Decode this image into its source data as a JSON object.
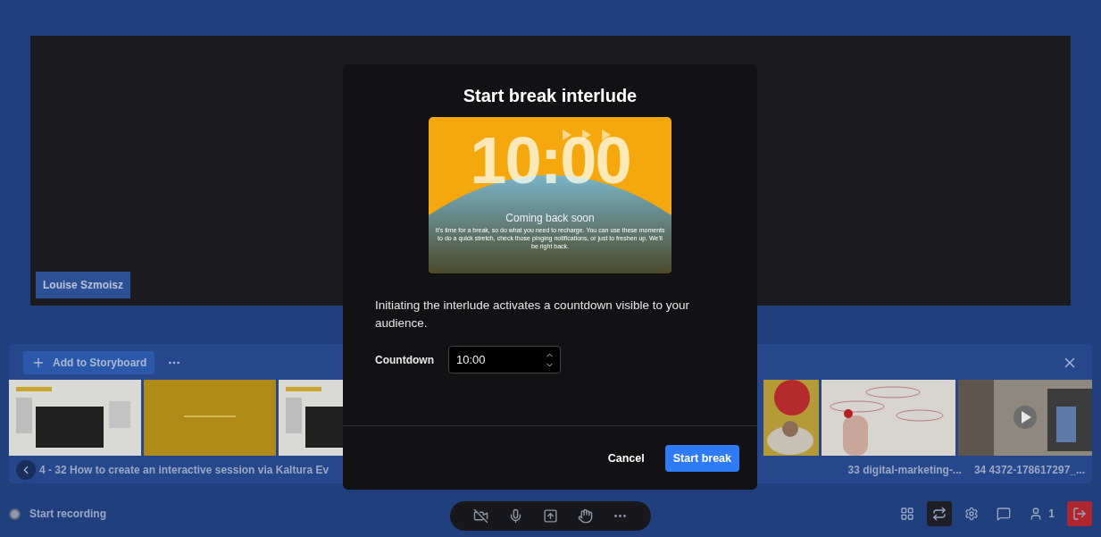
{
  "stage": {
    "participant": "Louise Szmoisz"
  },
  "storyboard": {
    "add_button": "Add to Storyboard",
    "thumbnails_left": [
      {
        "kind": "slide"
      },
      {
        "kind": "title-slide"
      },
      {
        "kind": "slide"
      }
    ],
    "thumbnails_right": [
      {
        "kind": "photo-warm"
      },
      {
        "kind": "photo-light"
      },
      {
        "kind": "video"
      }
    ],
    "caption_left": "4 - 32 How to create an interactive session via Kaltura Ev",
    "captions_right": [
      "33 digital-marketing-...",
      "34 4372-178617297_..."
    ]
  },
  "recording": {
    "label": "Start recording",
    "on": false
  },
  "controls": [
    {
      "kind": "camera-off"
    },
    {
      "kind": "mic"
    },
    {
      "kind": "share"
    },
    {
      "kind": "hand"
    },
    {
      "kind": "more"
    }
  ],
  "tools": [
    {
      "kind": "grid",
      "selected": false
    },
    {
      "kind": "switch",
      "selected": true
    },
    {
      "kind": "settings",
      "selected": false
    },
    {
      "kind": "chat",
      "selected": false
    },
    {
      "kind": "people",
      "selected": false,
      "count": "1"
    },
    {
      "kind": "leave",
      "selected": false
    }
  ],
  "modal": {
    "title": "Start break interlude",
    "preview": {
      "time": "10:00",
      "heading": "Coming back soon",
      "message": "It's time for a break, so do what you need to recharge. You can use these moments to do a quick stretch, check those pinging notifications, or just to freshen up. We'll be right back."
    },
    "description": "Initiating the interlude activates a countdown visible to your audience.",
    "countdown": {
      "label": "Countdown",
      "value": "10:00"
    },
    "buttons": [
      {
        "label": "Cancel",
        "kind": "secondary"
      },
      {
        "label": "Start break",
        "kind": "primary"
      }
    ]
  }
}
